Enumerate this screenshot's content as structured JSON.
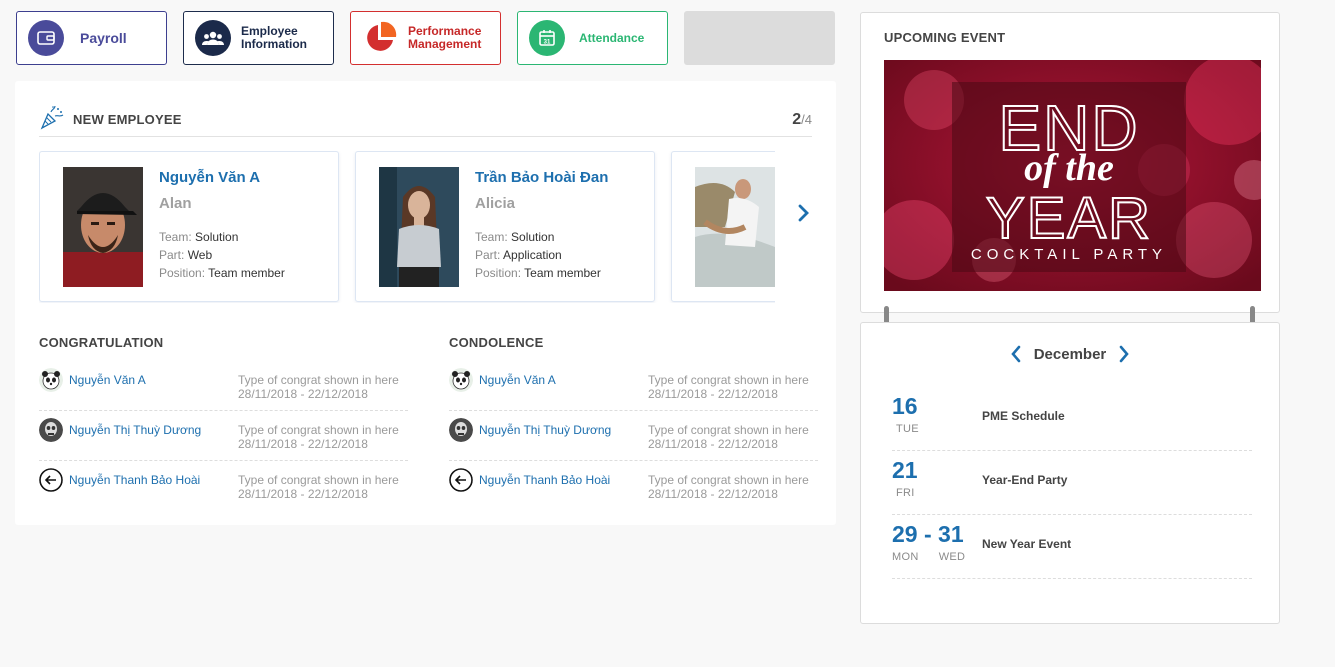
{
  "modules": {
    "payroll": "Payroll",
    "employee": "Employee Information",
    "performance": "Performance Management",
    "attendance": "Attendance"
  },
  "new_employee": {
    "title": "NEW EMPLOYEE",
    "page": "2",
    "total": "/4",
    "cards": [
      {
        "name": "Nguyễn Văn A",
        "nickname": "Alan",
        "team_label": "Team:",
        "team": "Solution",
        "part_label": "Part:",
        "part": "Web",
        "position_label": "Position:",
        "position": "Team member"
      },
      {
        "name": "Trần Bảo Hoài Đan",
        "nickname": "Alicia",
        "team_label": "Team:",
        "team": "Solution",
        "part_label": "Part:",
        "part": "Application",
        "position_label": "Position:",
        "position": "Team member"
      }
    ]
  },
  "congratulation": {
    "title": "CONGRATULATION",
    "items": [
      {
        "name": "Nguyễn Văn A",
        "type": "Type of congrat shown in here",
        "dates": "28/11/2018 - 22/12/2018",
        "avatar": "panda-avatar"
      },
      {
        "name": "Nguyễn Thị Thuỳ Dương",
        "type": "Type of congrat shown in here",
        "dates": "28/11/2018 - 22/12/2018",
        "avatar": "skull-avatar"
      },
      {
        "name": "Nguyễn Thanh Bảo Hoài",
        "type": "Type of congrat shown in here",
        "dates": "28/11/2018 - 22/12/2018",
        "avatar": "arrow-left-avatar"
      }
    ]
  },
  "condolence": {
    "title": "CONDOLENCE",
    "items": [
      {
        "name": "Nguyễn Văn A",
        "type": "Type of congrat shown in here",
        "dates": "28/11/2018 - 22/12/2018",
        "avatar": "panda-avatar"
      },
      {
        "name": "Nguyễn Thị Thuỳ Dương",
        "type": "Type of congrat shown in here",
        "dates": "28/11/2018 - 22/12/2018",
        "avatar": "skull-avatar"
      },
      {
        "name": "Nguyễn Thanh Bảo Hoài",
        "type": "Type of congrat shown in here",
        "dates": "28/11/2018 - 22/12/2018",
        "avatar": "arrow-left-avatar"
      }
    ]
  },
  "upcoming_event": {
    "title": "UPCOMING EVENT",
    "banner_line1": "END",
    "banner_line2": "of the",
    "banner_line3": "YEAR",
    "banner_line4": "COCKTAIL PARTY"
  },
  "calendar": {
    "month": "December",
    "events": [
      {
        "day": "16",
        "weekday": "TUE",
        "name": "PME Schedule"
      },
      {
        "day": "21",
        "weekday": "FRI",
        "name": "Year-End Party"
      },
      {
        "day": "29 - 31",
        "weekday": "MON      WED",
        "name": "New Year Event"
      }
    ]
  },
  "colors": {
    "accent_blue": "#1d6fae",
    "payroll": "#4a4b9a",
    "employee": "#1b2a4a",
    "performance": "#c62828",
    "attendance": "#2bb673"
  }
}
